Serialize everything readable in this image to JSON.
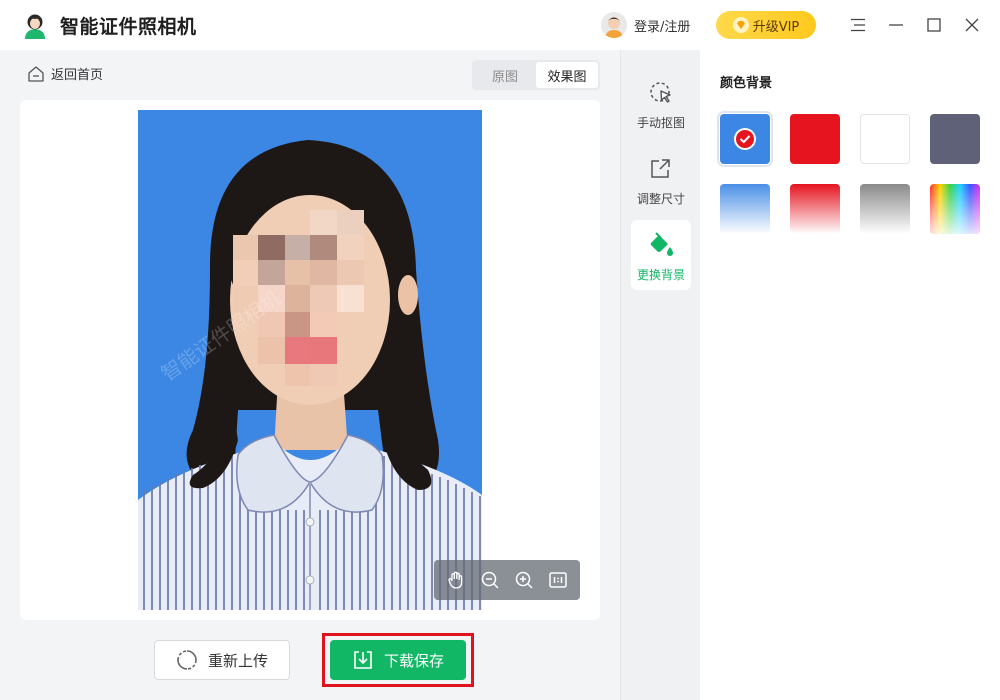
{
  "app": {
    "title": "智能证件照相机"
  },
  "header": {
    "login_label": "登录/注册",
    "vip_label": "升级VIP"
  },
  "nav": {
    "back_label": "返回首页"
  },
  "view_tabs": [
    {
      "label": "原图",
      "active": false
    },
    {
      "label": "效果图",
      "active": true
    }
  ],
  "tools": [
    {
      "label": "手动抠图",
      "icon": "cursor-select-icon",
      "active": false
    },
    {
      "label": "调整尺寸",
      "icon": "resize-icon",
      "active": false
    },
    {
      "label": "更换背景",
      "icon": "paint-bucket-icon",
      "active": true
    }
  ],
  "background_panel": {
    "title": "颜色背景",
    "swatches": [
      {
        "type": "solid",
        "color": "#3b87e3",
        "selected": true
      },
      {
        "type": "solid",
        "color": "#e5141f",
        "selected": false
      },
      {
        "type": "solid",
        "color": "#ffffff",
        "selected": false
      },
      {
        "type": "solid",
        "color": "#5f6178",
        "selected": false
      },
      {
        "type": "gradient",
        "colors": [
          "#4a8fe6",
          "#ffffff"
        ],
        "selected": false
      },
      {
        "type": "gradient",
        "colors": [
          "#e5141f",
          "#ffffff"
        ],
        "selected": false
      },
      {
        "type": "gradient",
        "colors": [
          "#8a8a8a",
          "#ffffff"
        ],
        "selected": false
      },
      {
        "type": "rainbow",
        "selected": false
      }
    ]
  },
  "photo": {
    "background_color": "#3b87e3",
    "watermark": "智能证件照相机"
  },
  "zoom_controls": [
    "hand-icon",
    "zoom-out-icon",
    "zoom-in-icon",
    "actual-size-icon"
  ],
  "actions": {
    "reupload_label": "重新上传",
    "save_label": "下载保存"
  },
  "colors": {
    "accent_green": "#12b766",
    "highlight_red": "#e0121b",
    "vip_yellow": "#ffd84a"
  }
}
